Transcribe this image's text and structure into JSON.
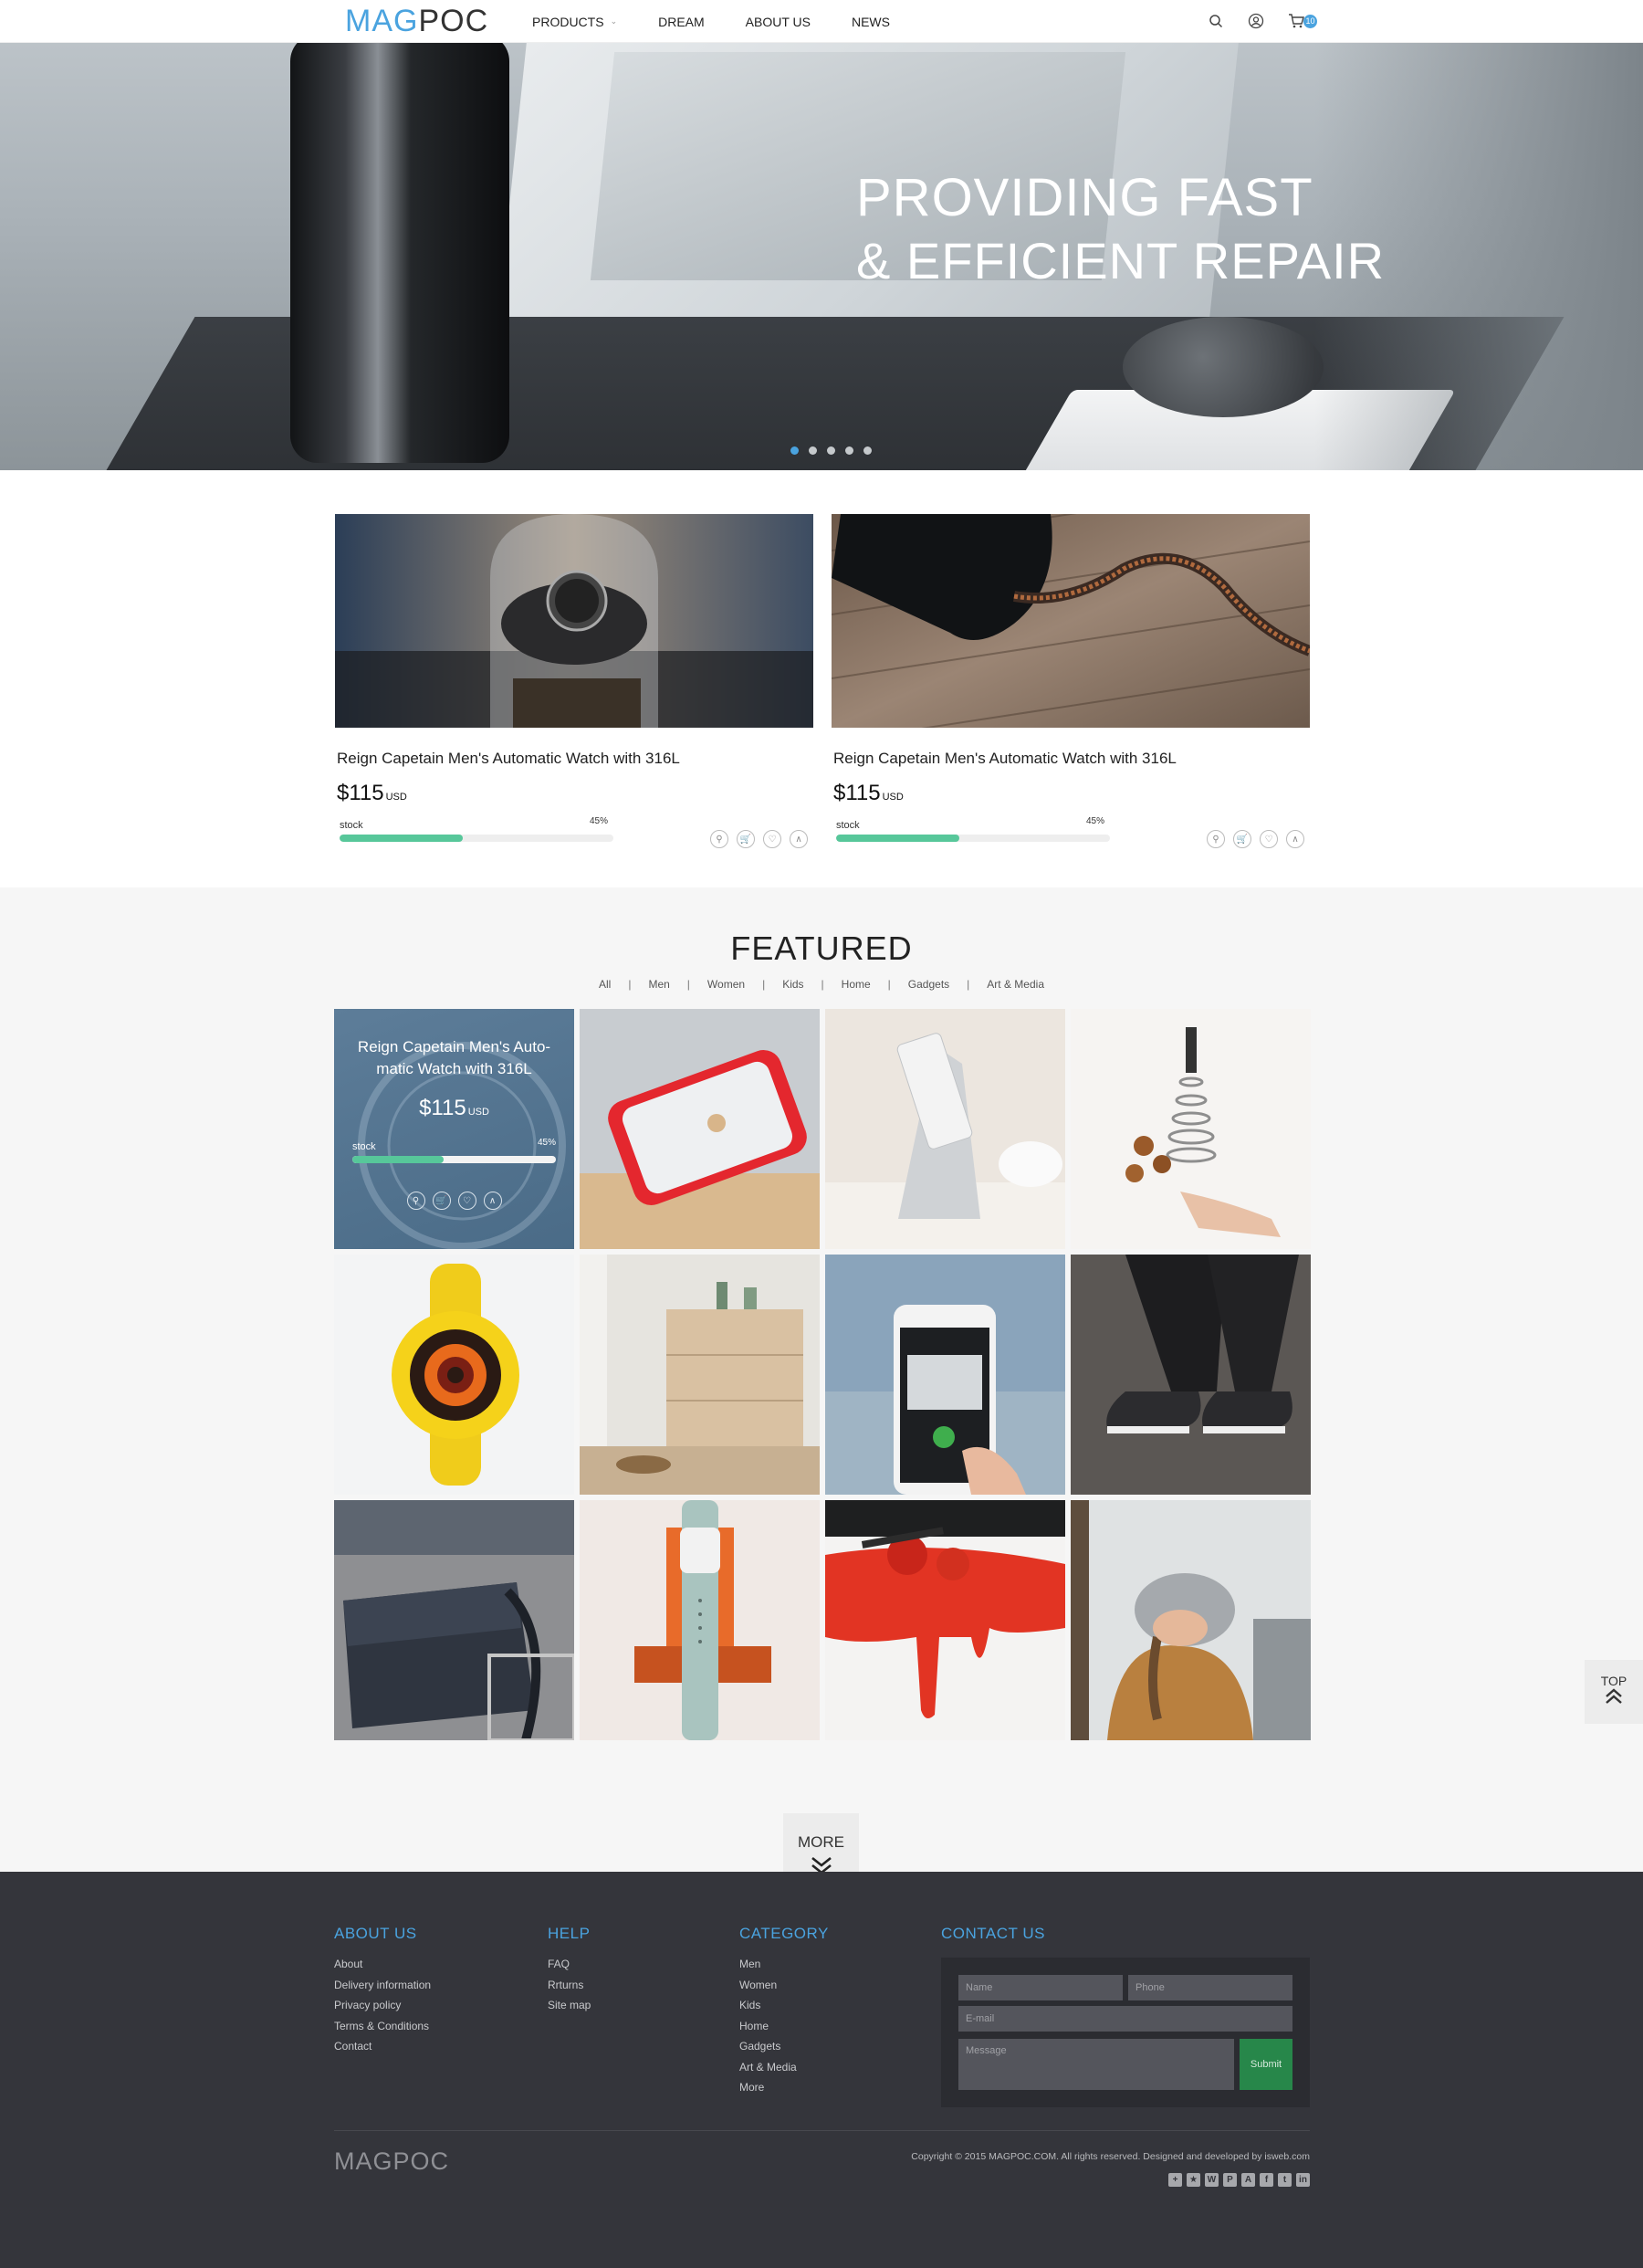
{
  "header": {
    "logo_mag": "MAG",
    "logo_poc": "POC",
    "nav": [
      "PRODUCTS",
      "DREAM",
      "ABOUT US",
      "NEWS"
    ],
    "cart_count": "10"
  },
  "hero": {
    "title_line1": "PROVIDING FAST",
    "title_line2": "& EFFICIENT REPAIR",
    "slide_count": 5,
    "active_slide": 1
  },
  "promos": [
    {
      "name": "Reign Capetain Men's Automatic Watch with 316L",
      "price": "$115",
      "currency": "USD",
      "stock_label": "stock",
      "stock_pct": "45%"
    },
    {
      "name": "Reign Capetain Men's Automatic Watch with 316L",
      "price": "$115",
      "currency": "USD",
      "stock_label": "stock",
      "stock_pct": "45%"
    }
  ],
  "featured": {
    "title": "FEATURED",
    "filters": [
      "All",
      "Men",
      "Women",
      "Kids",
      "Home",
      "Gadgets",
      "Art & Media"
    ],
    "overlay": {
      "name": "Reign Capetain Men's Auto-matic Watch with 316L",
      "price": "$115",
      "currency": "USD",
      "stock_label": "stock",
      "stock_pct": "45%"
    },
    "more_label": "MORE"
  },
  "back_to_top_label": "TOP",
  "footer": {
    "about_title": "ABOUT US",
    "about_links": [
      "About",
      "Delivery information",
      "Privacy policy",
      "Terms & Conditions",
      "Contact"
    ],
    "help_title": "HELP",
    "help_links": [
      "FAQ",
      "Rrturns",
      "Site map"
    ],
    "category_title": "CATEGORY",
    "category_links": [
      "Men",
      "Women",
      "Kids",
      "Home",
      "Gadgets",
      "Art & Media",
      "More"
    ],
    "contact_title": "CONTACT US",
    "name_placeholder": "Name",
    "phone_placeholder": "Phone",
    "email_placeholder": "E-mail",
    "message_placeholder": "Message",
    "submit_label": "Submit",
    "logo": "MAGPOC",
    "copyright": "Copyright © 2015 MAGPOC.COM. All rights reserved. Designed and developed by isweb.com"
  },
  "colors": {
    "accent": "#4aa3df",
    "stock": "#57c79a",
    "footer_bg": "#34353b",
    "submit": "#27874a"
  }
}
